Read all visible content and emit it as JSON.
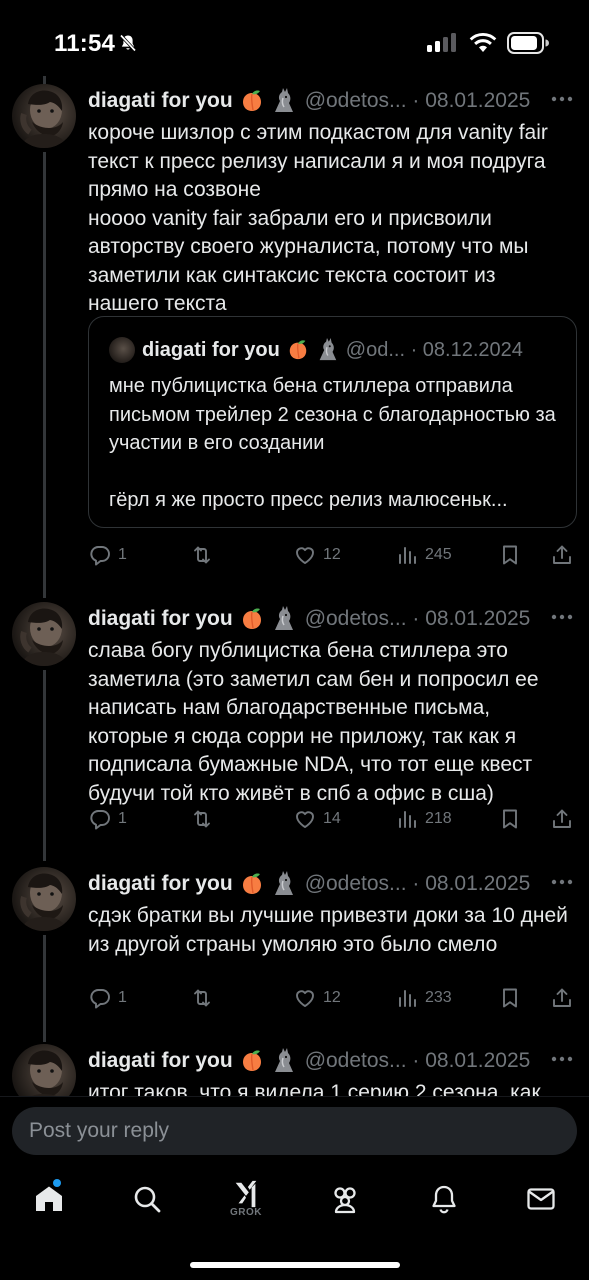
{
  "status_bar": {
    "time": "11:54"
  },
  "tweets": [
    {
      "author": "diagati for you",
      "handle": "@odetos...",
      "date": "08.01.2025",
      "text": "короче шизлор с этим подкастом для vanity fair текст к пресс релизу написали я и моя подруга прямо на созвоне\nнoooo vanity fair забрали его и присвоили авторству своего журналиста, потому что мы заметили как синтаксис текста состоит из нашего текста",
      "quote": {
        "author": "diagati for you",
        "handle": "@od...",
        "date": "08.12.2024",
        "text": "мне публицистка бена стиллера отправила письмом трейлер 2 сезона с благодарностью за участии в его создании\n\nгёрл я же просто пресс релиз малюсеньк..."
      },
      "stats": {
        "replies": "1",
        "reposts": "",
        "likes": "12",
        "views": "245"
      }
    },
    {
      "author": "diagati for you",
      "handle": "@odetos...",
      "date": "08.01.2025",
      "text": "слава богу публицистка бена стиллера это заметила (это заметил сам бен и попросил ее написать нам благодарственные письма, которые я сюда сорри не приложу, так как я подписала бумажные NDA, что тот еще квест будучи той кто живёт в спб а офис в сша)",
      "stats": {
        "replies": "1",
        "reposts": "",
        "likes": "14",
        "views": "218"
      }
    },
    {
      "author": "diagati for you",
      "handle": "@odetos...",
      "date": "08.01.2025",
      "text": "сдэк братки вы лучшие привезти доки за 10 дней из другой страны умоляю это было смело",
      "stats": {
        "replies": "1",
        "reposts": "",
        "likes": "12",
        "views": "233"
      }
    },
    {
      "author": "diagati for you",
      "handle": "@odetos...",
      "date": "08.01.2025",
      "text": "итог таков, что я видела 1 серию 2 сезона, как"
    }
  ],
  "reply": {
    "placeholder": "Post your reply"
  },
  "tabbar": {
    "grok_label": "GROK"
  },
  "colors": {
    "background": "#000000",
    "text": "#e7e9ea",
    "muted": "#71767b",
    "accent": "#1d9bf0",
    "border": "#2f3336"
  },
  "icons": [
    "bell-slash-icon",
    "signal-icon",
    "wifi-icon",
    "battery-icon",
    "more-icon",
    "reply-icon",
    "repost-icon",
    "like-icon",
    "views-icon",
    "bookmark-icon",
    "share-icon",
    "home-icon",
    "search-icon",
    "grok-icon",
    "communities-icon",
    "notifications-icon",
    "messages-icon"
  ]
}
